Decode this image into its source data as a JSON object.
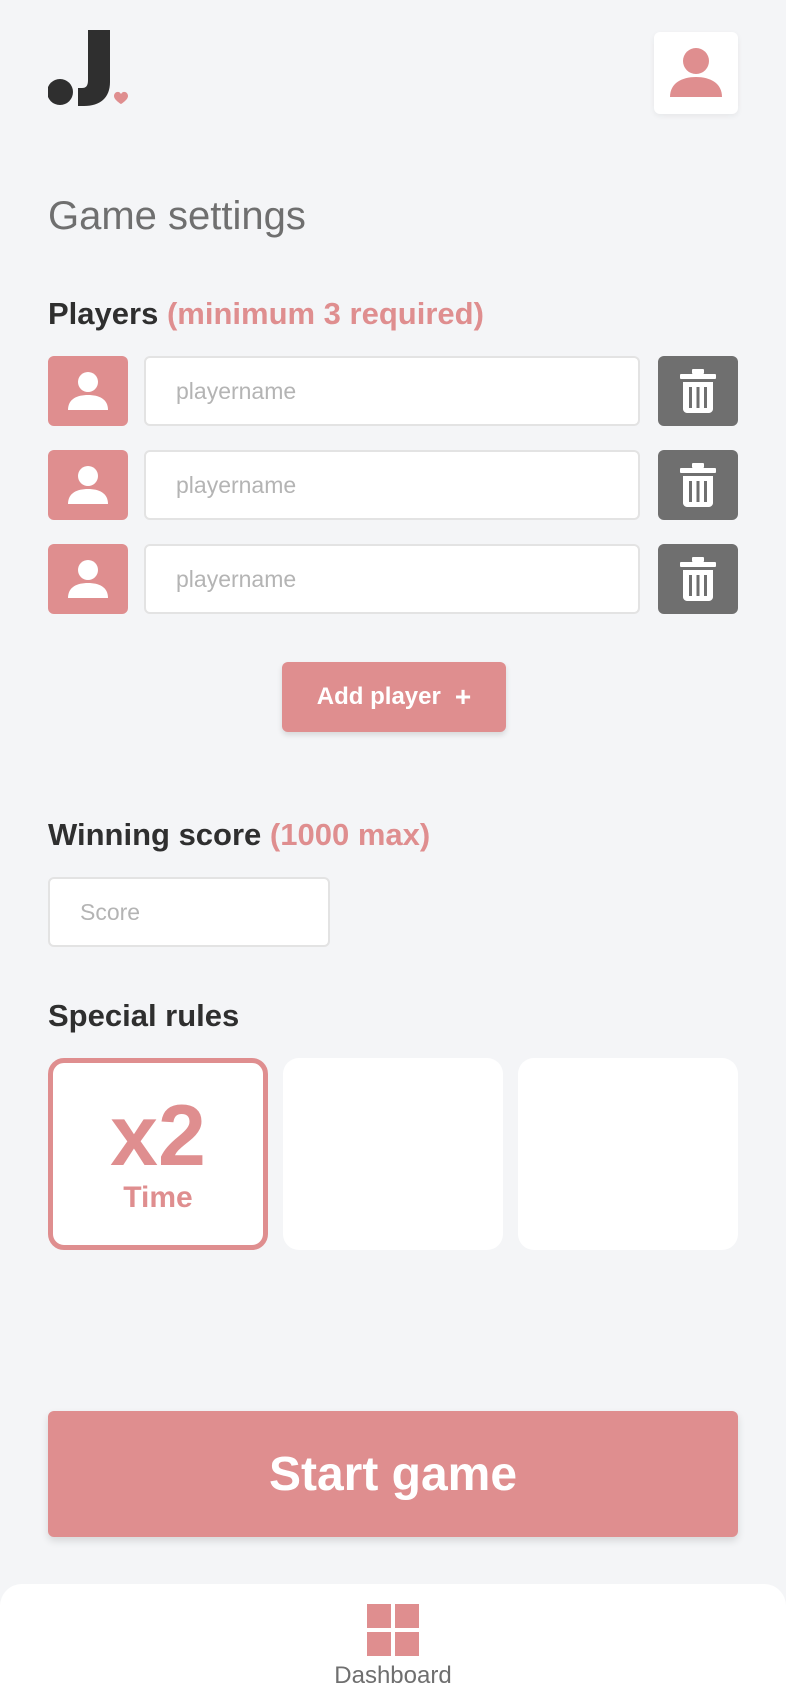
{
  "header": {
    "logo_text": "J.",
    "profile_icon": "user-icon"
  },
  "page": {
    "title": "Game settings"
  },
  "players": {
    "title": "Players",
    "note": "(minimum 3 required)",
    "rows": [
      {
        "placeholder": "playername",
        "value": "",
        "avatar_icon": "user-icon",
        "delete_icon": "trash-icon"
      },
      {
        "placeholder": "playername",
        "value": "",
        "avatar_icon": "user-icon",
        "delete_icon": "trash-icon"
      },
      {
        "placeholder": "playername",
        "value": "",
        "avatar_icon": "user-icon",
        "delete_icon": "trash-icon"
      }
    ],
    "add_label": "Add player",
    "add_icon": "+"
  },
  "winning_score": {
    "title": "Winning score",
    "note": "(1000 max)",
    "placeholder": "Score",
    "value": ""
  },
  "special_rules": {
    "title": "Special rules",
    "cards": [
      {
        "multiplier": "x2",
        "label": "Time",
        "selected": true
      },
      {
        "multiplier": "",
        "label": "",
        "selected": false
      },
      {
        "multiplier": "",
        "label": "",
        "selected": false
      }
    ]
  },
  "actions": {
    "start_label": "Start game"
  },
  "nav": {
    "items": [
      {
        "label": "Dashboard",
        "icon": "dashboard-icon"
      }
    ]
  },
  "colors": {
    "accent": "#df8e8f",
    "dark": "#2f2f2f",
    "grey_button": "#6f6f6f",
    "background": "#f4f5f7"
  }
}
